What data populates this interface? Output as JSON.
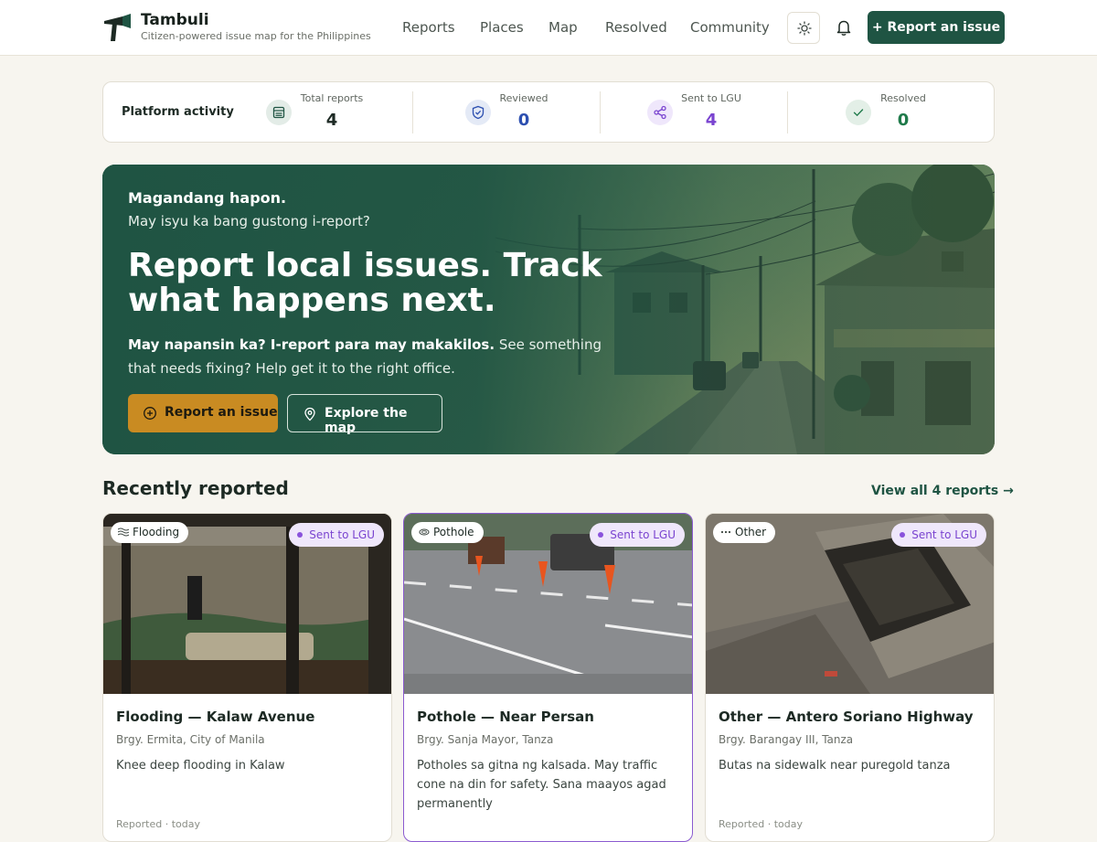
{
  "header": {
    "brand": "Tambuli",
    "tagline": "Citizen-powered issue map for the Philippines",
    "nav": [
      "Reports",
      "Places",
      "Map",
      "Resolved",
      "Community"
    ],
    "cta_label": "+ Report an issue",
    "theme_icon": "sun-icon",
    "notify_icon": "bell-icon"
  },
  "activity": {
    "title": "Platform activity",
    "stats": [
      {
        "label": "Total reports",
        "value": "4",
        "icon": "list-icon",
        "color": "#1d2a24"
      },
      {
        "label": "Reviewed",
        "value": "0",
        "icon": "shield-check-icon",
        "color": "#2c4fb0"
      },
      {
        "label": "Sent to LGU",
        "value": "4",
        "icon": "share-icon",
        "color": "#7a44d0"
      },
      {
        "label": "Resolved",
        "value": "0",
        "icon": "check-icon",
        "color": "#1f7a4a"
      }
    ]
  },
  "hero": {
    "greeting": "Magandang hapon.",
    "greeting_sub": "May isyu ka bang gustong i-report?",
    "headline": "Report local issues. Track what happens next.",
    "lead_bold": "May napansin ka? I-report para may makakilos.",
    "lead_rest": " See something that needs fixing? Help get it to the right office.",
    "primary_button": "Report an issue",
    "secondary_button": "Explore the map"
  },
  "recent": {
    "title": "Recently reported",
    "view_all": "View all 4 reports →",
    "cards": [
      {
        "category": "Flooding",
        "category_icon": "waves-icon",
        "status": "Sent to LGU",
        "title": "Flooding — Kalaw Avenue",
        "location": "Brgy. Ermita, City of Manila",
        "description": "Knee deep flooding in Kalaw",
        "footer": "Reported · today"
      },
      {
        "category": "Pothole",
        "category_icon": "pothole-icon",
        "status": "Sent to LGU",
        "title": "Pothole — Near Persan",
        "location": "Brgy. Sanja Mayor, Tanza",
        "description": "Potholes sa gitna ng kalsada. May traffic cone na din for safety. Sana maayos agad permanently",
        "footer": ""
      },
      {
        "category": "Other",
        "category_icon": "ellipsis-icon",
        "status": "Sent to LGU",
        "title": "Other — Antero Soriano Highway",
        "location": "Brgy. Barangay III, Tanza",
        "description": "Butas na sidewalk near puregold tanza",
        "footer": "Reported · today"
      }
    ]
  },
  "colors": {
    "brand_green": "#1f5443",
    "accent_gold": "#c98b22",
    "status_purple": "#7a44d0",
    "page_bg": "#f7f5ef"
  }
}
